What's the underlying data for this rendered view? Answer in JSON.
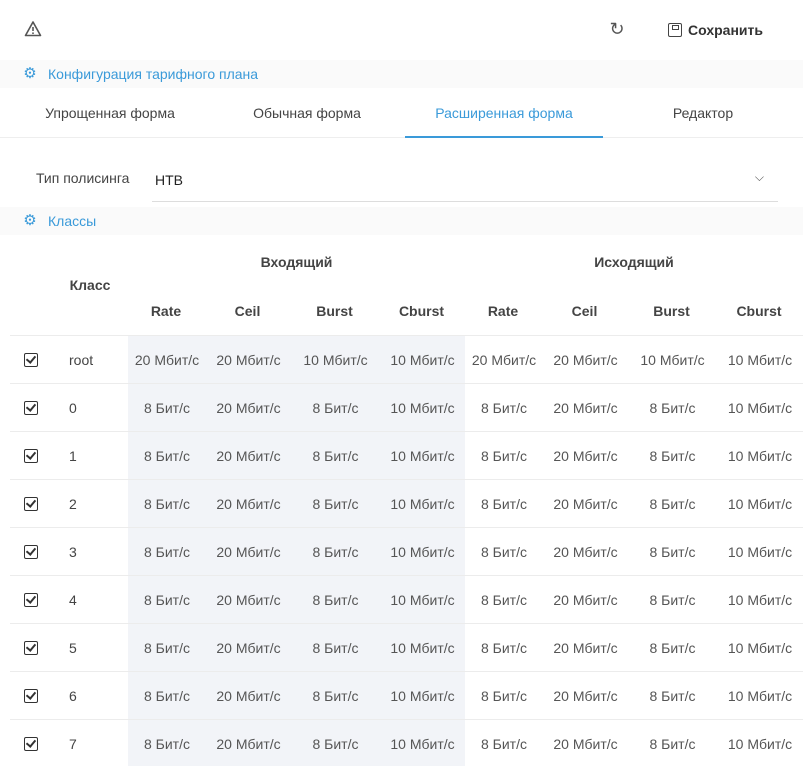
{
  "toolbar": {
    "warn_icon": "warning-icon",
    "refresh_icon": "refresh-icon",
    "save_label": "Сохранить"
  },
  "config_section": {
    "title": "Конфигурация тарифного плана",
    "icon": "gear-icon"
  },
  "tabs": [
    {
      "label": "Упрощенная форма",
      "active": false
    },
    {
      "label": "Обычная форма",
      "active": false
    },
    {
      "label": "Расширенная форма",
      "active": true
    },
    {
      "label": "Редактор",
      "active": false
    }
  ],
  "policing": {
    "label": "Тип полисинга",
    "value": "HTB"
  },
  "classes_section": {
    "title": "Классы",
    "icon": "gears-icon"
  },
  "table": {
    "class_header": "Класс",
    "incoming_header": "Входящий",
    "outgoing_header": "Исходящий",
    "columns": [
      "Rate",
      "Ceil",
      "Burst",
      "Cburst",
      "Rate",
      "Ceil",
      "Burst",
      "Cburst"
    ],
    "rows": [
      {
        "name": "root",
        "values": [
          "20 Мбит/с",
          "20 Мбит/с",
          "10 Мбит/с",
          "10 Мбит/с",
          "20 Мбит/с",
          "20 Мбит/с",
          "10 Мбит/с",
          "10 Мбит/с"
        ]
      },
      {
        "name": "0",
        "values": [
          "8 Бит/с",
          "20 Мбит/с",
          "8 Бит/с",
          "10 Мбит/с",
          "8 Бит/с",
          "20 Мбит/с",
          "8 Бит/с",
          "10 Мбит/с"
        ]
      },
      {
        "name": "1",
        "values": [
          "8 Бит/с",
          "20 Мбит/с",
          "8 Бит/с",
          "10 Мбит/с",
          "8 Бит/с",
          "20 Мбит/с",
          "8 Бит/с",
          "10 Мбит/с"
        ]
      },
      {
        "name": "2",
        "values": [
          "8 Бит/с",
          "20 Мбит/с",
          "8 Бит/с",
          "10 Мбит/с",
          "8 Бит/с",
          "20 Мбит/с",
          "8 Бит/с",
          "10 Мбит/с"
        ]
      },
      {
        "name": "3",
        "values": [
          "8 Бит/с",
          "20 Мбит/с",
          "8 Бит/с",
          "10 Мбит/с",
          "8 Бит/с",
          "20 Мбит/с",
          "8 Бит/с",
          "10 Мбит/с"
        ]
      },
      {
        "name": "4",
        "values": [
          "8 Бит/с",
          "20 Мбит/с",
          "8 Бит/с",
          "10 Мбит/с",
          "8 Бит/с",
          "20 Мбит/с",
          "8 Бит/с",
          "10 Мбит/с"
        ]
      },
      {
        "name": "5",
        "values": [
          "8 Бит/с",
          "20 Мбит/с",
          "8 Бит/с",
          "10 Мбит/с",
          "8 Бит/с",
          "20 Мбит/с",
          "8 Бит/с",
          "10 Мбит/с"
        ]
      },
      {
        "name": "6",
        "values": [
          "8 Бит/с",
          "20 Мбит/с",
          "8 Бит/с",
          "10 Мбит/с",
          "8 Бит/с",
          "20 Мбит/с",
          "8 Бит/с",
          "10 Мбит/с"
        ]
      },
      {
        "name": "7",
        "values": [
          "8 Бит/с",
          "20 Мбит/с",
          "8 Бит/с",
          "10 Мбит/с",
          "8 Бит/с",
          "20 Мбит/с",
          "8 Бит/с",
          "10 Мбит/с"
        ]
      }
    ]
  }
}
